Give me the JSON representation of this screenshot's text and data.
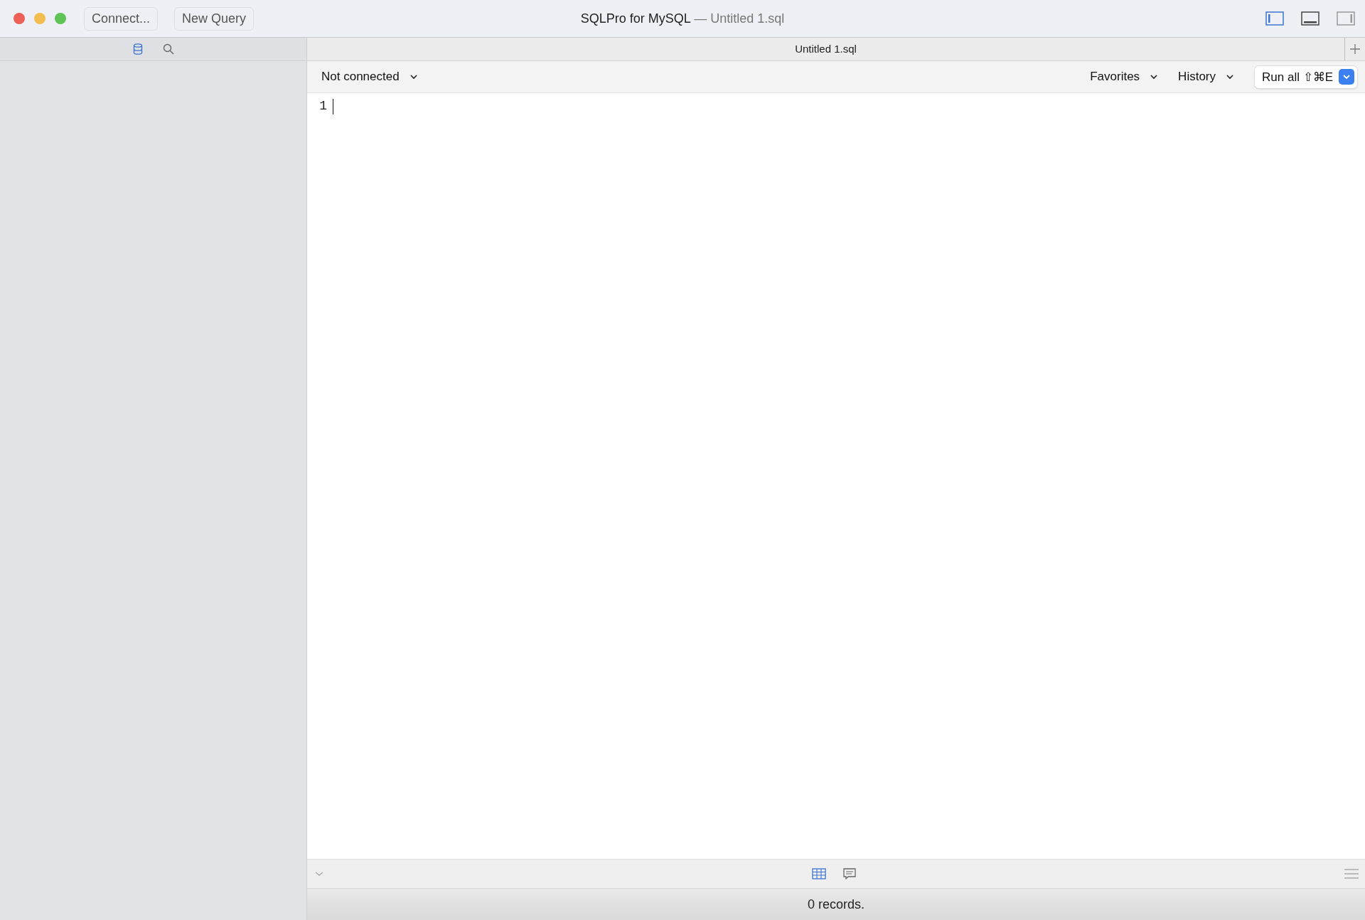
{
  "window": {
    "app_name": "SQLPro for MySQL",
    "document": "— Untitled 1.sql"
  },
  "toolbar_buttons": [
    "Connect...",
    "New Query"
  ],
  "panel_toggles": [
    {
      "kind": "left",
      "on": true
    },
    {
      "kind": "bottom",
      "on": true
    },
    {
      "kind": "right",
      "on": false
    }
  ],
  "sidebar": {
    "tabs": [
      {
        "kind": "database",
        "selected": true
      },
      {
        "kind": "search",
        "selected": false
      }
    ]
  },
  "tabs": [
    {
      "label": "Untitled 1.sql",
      "selected": true
    }
  ],
  "query_bar": {
    "connection": "Not connected",
    "menus": [
      "Favorites",
      "History"
    ],
    "run_button": "Run all ⇧⌘E"
  },
  "editor": {
    "line_numbers": [
      "1"
    ]
  },
  "results_bar": {
    "views": [
      {
        "kind": "grid",
        "selected": true
      },
      {
        "kind": "messages",
        "selected": false
      }
    ]
  },
  "status_bar": "0 records."
}
